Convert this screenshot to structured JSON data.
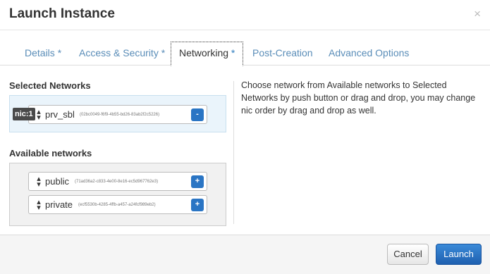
{
  "modal": {
    "title": "Launch Instance",
    "close_symbol": "×"
  },
  "tabs": [
    {
      "label": "Details",
      "required": "*"
    },
    {
      "label": "Access & Security",
      "required": "*"
    },
    {
      "label": "Networking",
      "required": "*"
    },
    {
      "label": "Post-Creation",
      "required": ""
    },
    {
      "label": "Advanced Options",
      "required": ""
    }
  ],
  "selected_networks": {
    "heading": "Selected Networks",
    "items": [
      {
        "nic": "nic:1",
        "name": "prv_sbl",
        "id": "(02bc0049-f6f9-4b55-bd26-83ab2f2c5226)",
        "button": "-"
      }
    ]
  },
  "available_networks": {
    "heading": "Available networks",
    "items": [
      {
        "name": "public",
        "id": "(71ad36a2-c833-4e00-8e16-ec5d967762e3)",
        "button": "+"
      },
      {
        "name": "private",
        "id": "(ecf5530b-4285-4ffb-a457-a24fcf989eb2)",
        "button": "+"
      }
    ]
  },
  "help_text": "Choose network from Available networks to Selected Networks by push button or drag and drop, you may change nic order by drag and drop as well.",
  "footer": {
    "cancel_label": "Cancel",
    "launch_label": "Launch"
  },
  "icons": {
    "sort_arrows": "up-down-arrows-icon"
  },
  "colors": {
    "accent": "#2a75c4",
    "tab_link": "#5a8db8",
    "selected_bg": "#eaf4fb"
  }
}
